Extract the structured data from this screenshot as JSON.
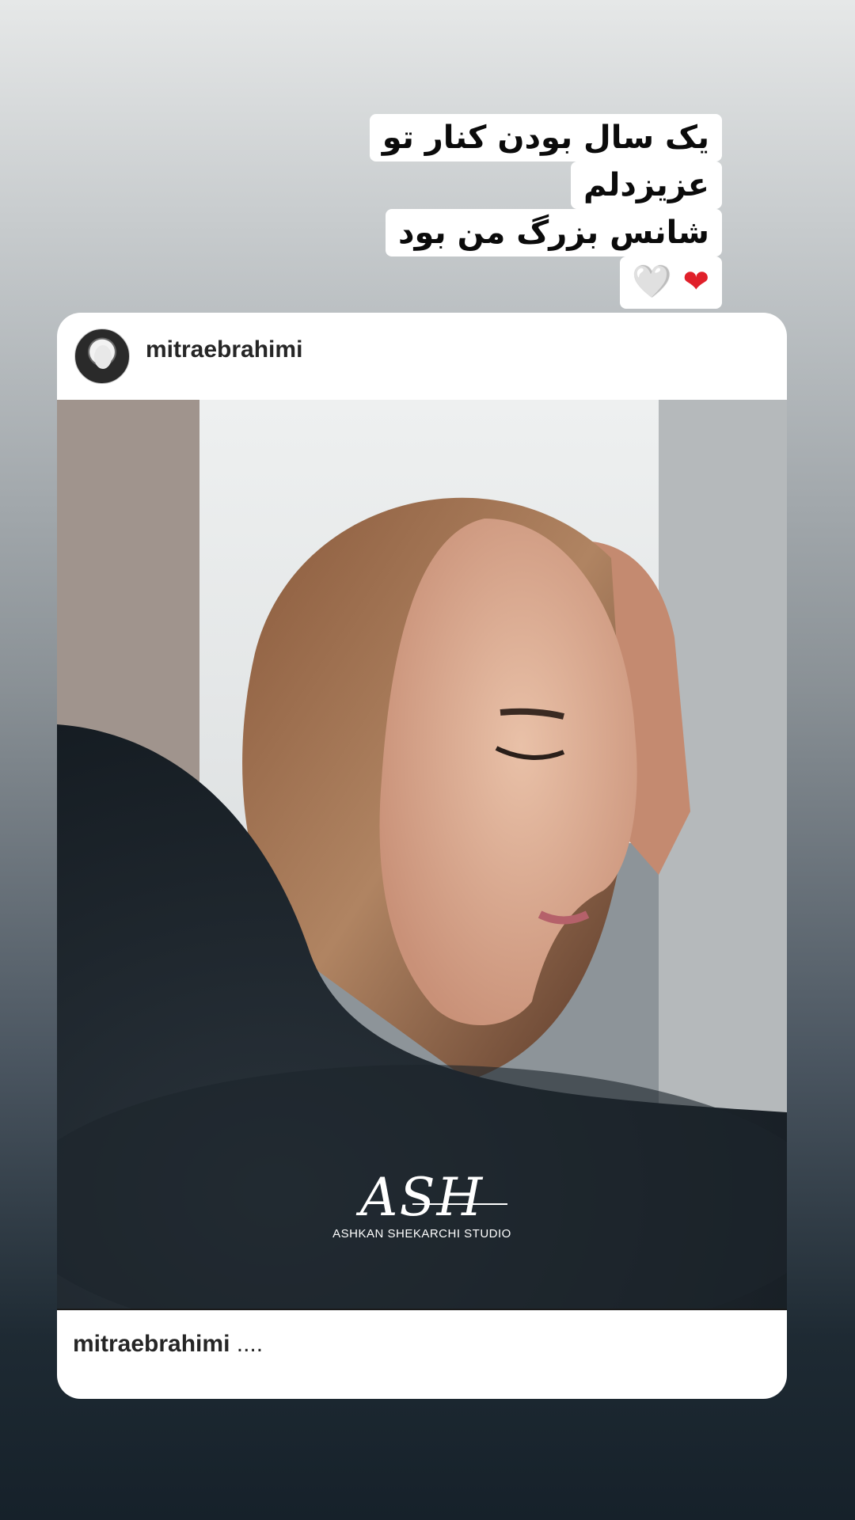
{
  "story": {
    "caption_lines": [
      "یک سال بودن کنار تو",
      "عزیزدلم",
      "شانس بزرگ من بود"
    ],
    "emoji_white_heart": "🤍",
    "emoji_red_heart": "❤"
  },
  "post": {
    "username": "mitraebrahimi",
    "photo": {
      "watermark_logo": "ASH",
      "watermark_text": "ASHKAN SHEKARCHI STUDIO"
    },
    "footer": {
      "username": "mitraebrahimi",
      "caption": " ...."
    }
  }
}
